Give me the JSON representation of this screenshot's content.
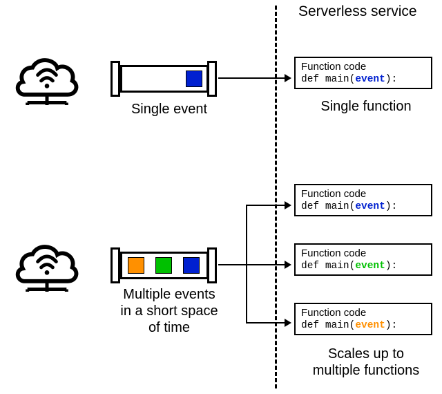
{
  "header": {
    "title": "Serverless service"
  },
  "single": {
    "event_label": "Single event",
    "function_label": "Single function",
    "fnbox": {
      "title": "Function code",
      "def": "def ",
      "main_open": "main(",
      "event_kw": "event",
      "main_close": "):"
    },
    "event_color": "blue"
  },
  "multi": {
    "event_label": "Multiple events\nin a short space\nof time",
    "function_label": "Scales up to\nmultiple functions",
    "fnboxes": [
      {
        "title": "Function code",
        "def": "def ",
        "main_open": "main(",
        "event_kw": "event",
        "main_close": "):",
        "kw_color": "#0020d0"
      },
      {
        "title": "Function code",
        "def": "def ",
        "main_open": "main(",
        "event_kw": "event",
        "main_close": "):",
        "kw_color": "#00c000"
      },
      {
        "title": "Function code",
        "def": "def ",
        "main_open": "main(",
        "event_kw": "event",
        "main_close": "):",
        "kw_color": "#ff9000"
      }
    ],
    "event_colors": [
      "orange",
      "green",
      "blue"
    ]
  }
}
